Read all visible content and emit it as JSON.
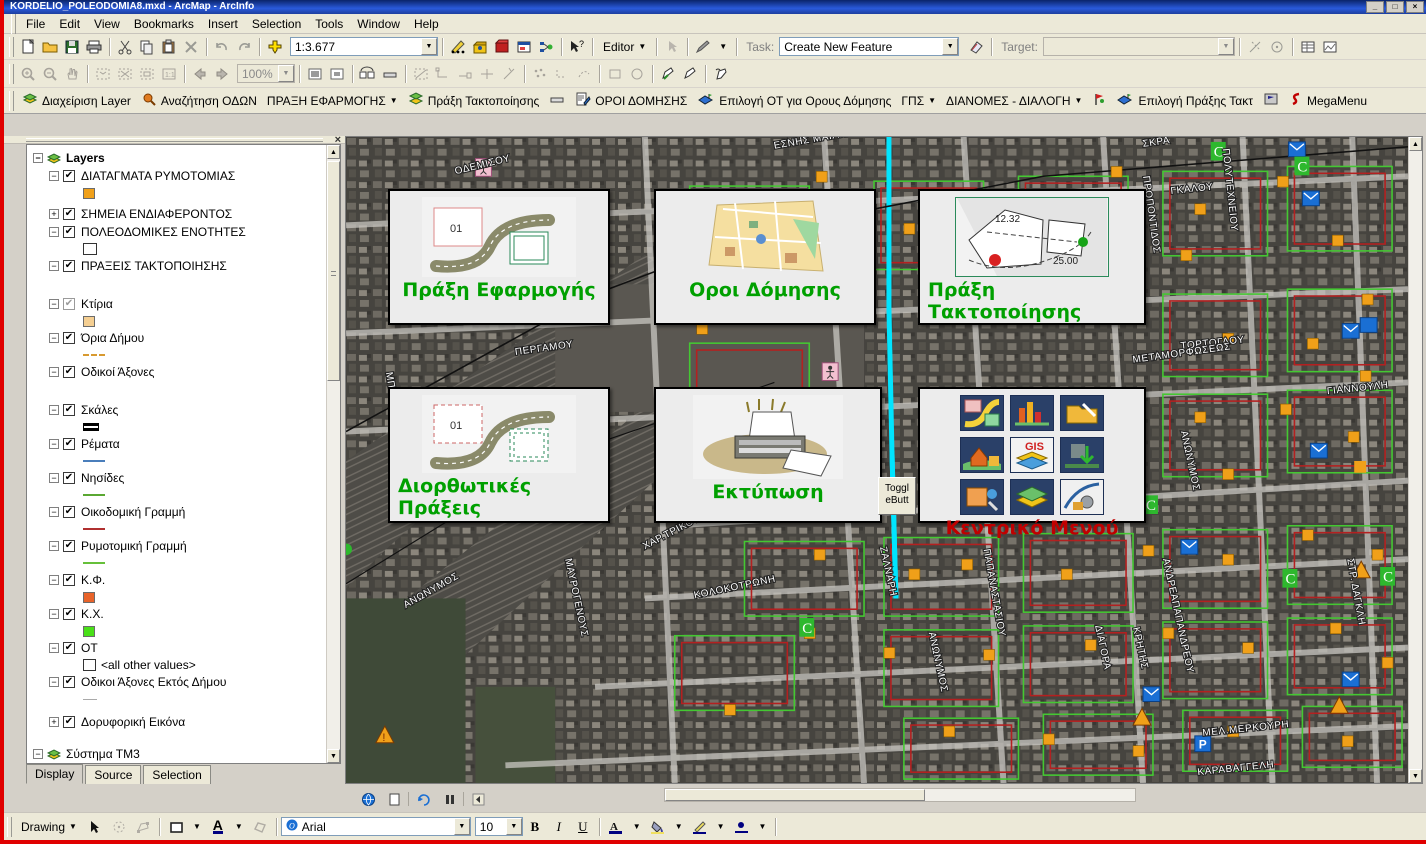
{
  "window": {
    "title": "KORDELIO_POLEODOMIA8.mxd - ArcMap - ArcInfo",
    "minimize": "_",
    "maximize": "□",
    "close": "×"
  },
  "menubar": {
    "items": [
      {
        "label": "File"
      },
      {
        "label": "Edit"
      },
      {
        "label": "View"
      },
      {
        "label": "Bookmarks"
      },
      {
        "label": "Insert"
      },
      {
        "label": "Selection"
      },
      {
        "label": "Tools"
      },
      {
        "label": "Window"
      },
      {
        "label": "Help"
      }
    ]
  },
  "standard_toolbar": {
    "buttons": [
      {
        "name": "new-map-icon",
        "glyph": "⬜"
      },
      {
        "name": "open-map-icon",
        "glyph": "📂"
      },
      {
        "name": "save-map-icon",
        "glyph": "💾"
      },
      {
        "name": "print-icon",
        "glyph": "🖨"
      },
      {
        "name": "cut-icon",
        "glyph": "✂"
      },
      {
        "name": "copy-icon",
        "glyph": "❐"
      },
      {
        "name": "paste-icon",
        "glyph": "📋"
      },
      {
        "name": "delete-icon",
        "glyph": "✕"
      },
      {
        "name": "undo-icon",
        "glyph": "↶"
      },
      {
        "name": "redo-icon",
        "glyph": "↷"
      },
      {
        "name": "add-data-icon",
        "glyph": "➕"
      }
    ],
    "scale_value": "1:3.677",
    "after_scale": [
      {
        "name": "editor-tool-icon",
        "glyph": "✎"
      },
      {
        "name": "arctoolbox-icon",
        "glyph": "🧰"
      },
      {
        "name": "show-commands-icon",
        "glyph": "📕"
      },
      {
        "name": "python-window-icon",
        "glyph": "▣"
      },
      {
        "name": "model-builder-icon",
        "glyph": "⊸"
      },
      {
        "name": "whats-this-help-icon",
        "glyph": "↖?"
      }
    ],
    "editor_label": "Editor",
    "task_label": "Task:",
    "task_value": "Create New Feature",
    "target_label": "Target:",
    "target_value": ""
  },
  "tools_toolbar": {
    "zoom_value": "100%",
    "buttons": [
      {
        "name": "zoom-in-icon",
        "glyph": "🔍"
      },
      {
        "name": "zoom-out-icon",
        "glyph": "🔍"
      },
      {
        "name": "pan-icon",
        "glyph": "✋"
      },
      {
        "name": "full-extent-icon",
        "glyph": "⛶"
      },
      {
        "name": "fixed-zoom-in-icon",
        "glyph": "⬚"
      },
      {
        "name": "fixed-zoom-out-icon",
        "glyph": "⬚"
      },
      {
        "name": "one-to-one-icon",
        "glyph": "1:1"
      },
      {
        "name": "go-back-extent-icon",
        "glyph": "⬅"
      },
      {
        "name": "go-forward-extent-icon",
        "glyph": "➡"
      },
      {
        "name": "page-layout-icon",
        "glyph": "▣"
      },
      {
        "name": "data-view-icon",
        "glyph": "▣"
      },
      {
        "name": "refresh-icon",
        "glyph": "↻"
      },
      {
        "name": "toggle-draw-icon",
        "glyph": "▬"
      },
      {
        "name": "sketch-tool-icon",
        "glyph": "⬚"
      },
      {
        "name": "trace-icon",
        "glyph": "⌐"
      },
      {
        "name": "endpoint-arc-icon",
        "glyph": "⊢"
      },
      {
        "name": "intersection-icon",
        "glyph": "✕"
      },
      {
        "name": "distance-distance-icon",
        "glyph": "∴"
      },
      {
        "name": "arc-tool-icon",
        "glyph": "∴"
      },
      {
        "name": "tangent-curve-icon",
        "glyph": "∴"
      },
      {
        "name": "rectangle-tool-icon",
        "glyph": "□"
      },
      {
        "name": "circle-tool-icon",
        "glyph": "○"
      },
      {
        "name": "cut-polygon-icon",
        "glyph": "✎"
      },
      {
        "name": "reshape-feature-icon",
        "glyph": "✎"
      },
      {
        "name": "mirror-feature-icon",
        "glyph": "✎"
      }
    ]
  },
  "custom_toolbar": {
    "items": [
      {
        "label": "Διαχείριση Layer",
        "icon": "layers-icon",
        "dropdown": false
      },
      {
        "label": "Αναζήτηση ΟΔΩΝ",
        "icon": "search-street-icon",
        "dropdown": false
      },
      {
        "label": "ΠΡΑΞΗ ΕΦΑΡΜΟΓΗΣ",
        "icon": "none",
        "dropdown": true
      },
      {
        "label": "Πράξη Τακτοποίησης",
        "icon": "tactopoiisi-icon",
        "dropdown": false
      },
      {
        "label": "",
        "icon": "bar-icon",
        "dropdown": false
      },
      {
        "label": "ΟΡΟΙ ΔΟΜΗΣΗΣ",
        "icon": "form-edit-icon",
        "dropdown": false
      },
      {
        "label": "Επιλογή ΟΤ για Ορους Δόμησης",
        "icon": "select-ot-icon",
        "dropdown": false
      },
      {
        "label": "ΓΠΣ",
        "icon": "none",
        "dropdown": true
      },
      {
        "label": "ΔΙΑΝΟΜΕΣ - ΔΙΑΛΟΓΗ",
        "icon": "none",
        "dropdown": true
      },
      {
        "label": "",
        "icon": "pin-icon",
        "dropdown": false
      },
      {
        "label": "Επιλογή Πράξης Τακτ",
        "icon": "select-praxi-icon",
        "dropdown": false
      },
      {
        "label": "",
        "icon": "flag-icon",
        "dropdown": false
      },
      {
        "label": "MegaMenu",
        "icon": "megamenu-icon",
        "dropdown": false
      }
    ]
  },
  "toc": {
    "close_label": "×",
    "root": "Layers",
    "layers": [
      {
        "label": "ΔΙΑΤΑΓΜΑΤΑ ΡΥΜΟΤΟΜΙΑΣ",
        "expand": "-",
        "checked": true,
        "sym": "square",
        "color": "#f0a019"
      },
      {
        "label": "ΣΗΜΕΙΑ ΕΝΔΙΑΦΕΡΟΝΤΟΣ",
        "expand": "+",
        "checked": true,
        "sym": "none",
        "color": ""
      },
      {
        "label": "ΠΟΛΕΟΔΟΜΙΚΕΣ ΕΝΟΤΗΤΕΣ",
        "expand": "-",
        "checked": true,
        "sym": "hollow",
        "color": "#ffffff"
      },
      {
        "label": "ΠΡΑΞΕΙΣ ΤΑΚΤΟΠΟΙΗΣΗΣ",
        "expand": "-",
        "checked": true,
        "sym": "blank",
        "color": ""
      },
      {
        "label": "Κτίρια",
        "expand": "-",
        "checked": true,
        "gray": true,
        "sym": "square",
        "color": "#f5cf92"
      },
      {
        "label": "Όρια Δήμου",
        "expand": "-",
        "checked": true,
        "sym": "dashline",
        "color": "#d89a30"
      },
      {
        "label": "Οδικοί Άξονες",
        "expand": "-",
        "checked": true,
        "sym": "blank",
        "color": ""
      },
      {
        "label": "Σκάλες",
        "expand": "-",
        "checked": true,
        "sym": "ladder",
        "color": "#000000"
      },
      {
        "label": "Ρέματα",
        "expand": "-",
        "checked": true,
        "sym": "line",
        "color": "#4a7ebb"
      },
      {
        "label": "Νησίδες",
        "expand": "-",
        "checked": true,
        "sym": "line",
        "color": "#5aa832"
      },
      {
        "label": "Οικοδομική Γραμμή",
        "expand": "-",
        "checked": true,
        "sym": "line",
        "color": "#b03030"
      },
      {
        "label": "Ρυμοτομική Γραμμή",
        "expand": "-",
        "checked": true,
        "sym": "line",
        "color": "#66c03a"
      },
      {
        "label": "Κ.Φ.",
        "expand": "-",
        "checked": true,
        "sym": "square",
        "color": "#e8632a"
      },
      {
        "label": "Κ.Χ.",
        "expand": "-",
        "checked": true,
        "sym": "square",
        "color": "#49e018"
      },
      {
        "label": "ΟΤ",
        "expand": "-",
        "checked": true,
        "sym": "other",
        "color": "#ffffff",
        "other_label": "<all other values>"
      },
      {
        "label": "Οδικοι Άξονες Εκτός Δήμου",
        "expand": "-",
        "checked": true,
        "sym": "line",
        "color": "#a9a9a9"
      },
      {
        "label": "Δορυφορική Εικόνα",
        "expand": "+",
        "checked": true,
        "sym": "none",
        "color": ""
      }
    ],
    "second_root": "Σύστημα ΤΜ3",
    "tabs": [
      {
        "label": "Display",
        "selected": true
      },
      {
        "label": "Source",
        "selected": false
      },
      {
        "label": "Selection",
        "selected": false
      }
    ]
  },
  "panels": [
    {
      "id": "praxi-efarmogis",
      "label": "Πράξη Εφαρμογής",
      "icon": "road-parcel-icon",
      "badge": "01",
      "color": "#00a000"
    },
    {
      "id": "oroi-domisis",
      "label": "Οροι Δόμησης",
      "icon": "city-map-icon",
      "color": "#00a000"
    },
    {
      "id": "praxi-taktopoiisis",
      "label": "Πράξη Τακτοποίησης",
      "icon": "parcel-dim-icon",
      "dim_a": "12.32",
      "dim_b": "25.00",
      "color": "#00a000"
    },
    {
      "id": "diorthotikes-praxeis",
      "label": "Διορθωτικές Πράξεις",
      "icon": "road-parcel-dashed-icon",
      "badge": "01",
      "color": "#00a000"
    },
    {
      "id": "ektyposi",
      "label": "Εκτύπωση",
      "icon": "printer-icon",
      "color": "#00a000",
      "toggle_button": "Toggl eButt"
    },
    {
      "id": "kentriko-menou",
      "label": "Κεντρικό Μενού",
      "icon": "icon-grid",
      "color": "#c00000"
    }
  ],
  "map": {
    "streets": [
      "ΟΔΕΜΙΣΟΥ",
      "ΕΣΝΗΣ ΜΑΙΑΝΔΡΟΥ",
      "ΣΚΡΑ",
      "ΠΟΛΥΤΕΧΝΕΙΟΥ",
      "ΓΚΑΛΟΥ",
      "ΤΟΡΤΟΓΛΟΥ",
      "ΜΕΤΑΜΟΡΦΩΣΕΩΣ",
      "ΓΙΑΝΝΟΥΛΗ",
      "ΑΝΔΡΕΑΠΑΠΑΝΔΡΕΟΥ",
      "ΑΝΩΝΥΜΟΣ",
      "ΧΑΡ. ΤΡΙΚΟΥΠΗ",
      "ΚΟΛΟΚΟΤΡΩΝΗ",
      "ΜΑΥΡΟΓΕΝΟΥΣ",
      "ΖΑΛΝΑΡΗ",
      "ΠΑΠΑΝΑΣΤΑΣΙΟΥ",
      "ΚΡΗΤΗΣ",
      "ΔΙΑΓΟΡΑ",
      "ΜΕΛ.ΜΕΡΚΟΥΡΗ",
      "ΚΑΡΑΒΑΓΓΕΛΗ",
      "ΠΕΡΓΑΜΟΥ",
      "ΜΠΟΤΣΑΡΗ",
      "ΣΤΡ. ΔΑΓΚΛΗ"
    ],
    "marker_colors": {
      "poi_orange": "#f0a019",
      "pharmacy_green": "#2eb82e",
      "mail_blue": "#1a6fd4",
      "parcel_red": "#b22222",
      "parcel_green": "#2db82d",
      "stream_cyan": "#00e5ff"
    }
  },
  "status": {
    "draw_buttons": [
      {
        "name": "globe-icon",
        "glyph": "🌐"
      },
      {
        "name": "page-icon",
        "glyph": "🗋"
      },
      {
        "name": "refresh-view-icon",
        "glyph": "↻"
      },
      {
        "name": "pause-draw-icon",
        "glyph": "❚❚"
      },
      {
        "name": "collapse-icon",
        "glyph": "◀"
      }
    ]
  },
  "drawbar": {
    "label": "Drawing",
    "font_name": "Arial",
    "font_size": "10",
    "bold": "B",
    "italic": "I",
    "underline": "U",
    "buttons": [
      {
        "name": "select-elements-icon",
        "glyph": "⬉"
      },
      {
        "name": "rotate-icon",
        "glyph": "↻"
      },
      {
        "name": "edit-vertices-icon",
        "glyph": "⌗"
      },
      {
        "name": "new-rectangle-icon",
        "glyph": "□"
      },
      {
        "name": "new-text-icon",
        "glyph": "A"
      },
      {
        "name": "shape-icon",
        "glyph": "⬡"
      },
      {
        "name": "font-color-icon",
        "glyph": "A"
      },
      {
        "name": "fill-color-icon",
        "glyph": "◢"
      },
      {
        "name": "line-color-icon",
        "glyph": "╱"
      },
      {
        "name": "marker-color-icon",
        "glyph": "●"
      }
    ]
  }
}
